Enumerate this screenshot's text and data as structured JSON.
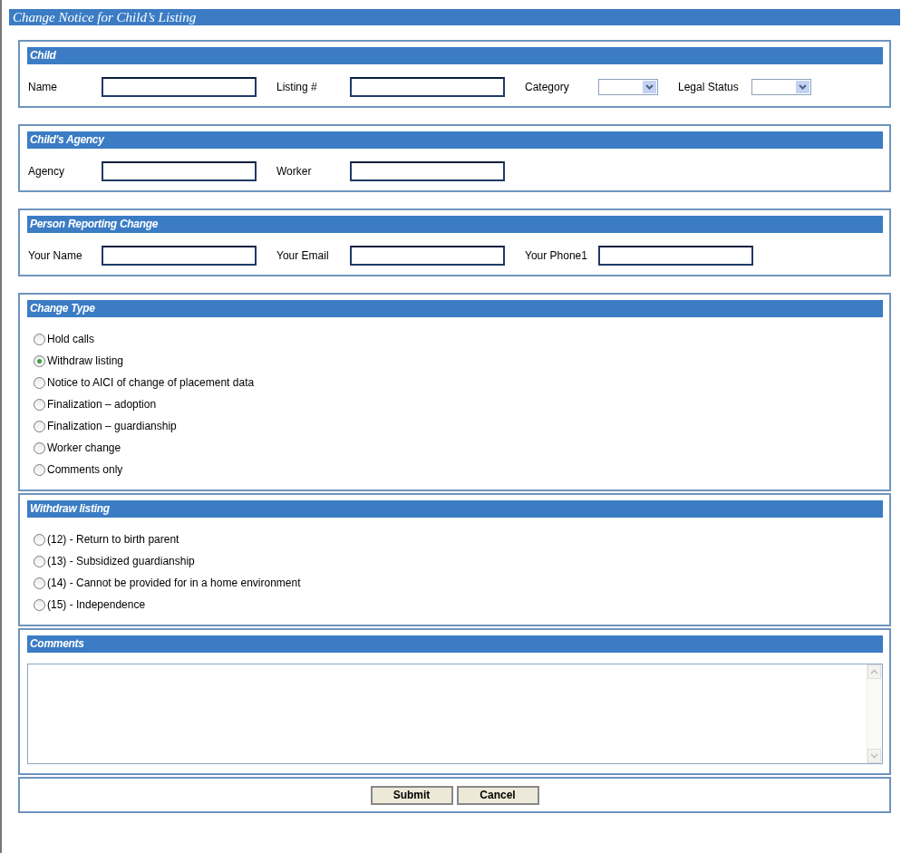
{
  "window": {
    "title": "Change Notice for Child’s Listing"
  },
  "sections": [
    {
      "kind": "fields",
      "title": "Child",
      "fields": [
        {
          "label": "Name",
          "kind": "text"
        },
        {
          "label": "Listing #",
          "kind": "text"
        },
        {
          "label": "Category",
          "kind": "select"
        },
        {
          "label": "Legal Status",
          "kind": "select"
        }
      ]
    },
    {
      "kind": "fields",
      "title": "Child's Agency",
      "fields": [
        {
          "label": "Agency",
          "kind": "text"
        },
        {
          "label": "Worker",
          "kind": "text"
        }
      ]
    },
    {
      "kind": "fields",
      "title": "Person Reporting Change",
      "fields": [
        {
          "label": "Your Name",
          "kind": "text"
        },
        {
          "label": "Your Email",
          "kind": "text"
        },
        {
          "label": "Your Phone1",
          "kind": "text"
        }
      ]
    },
    {
      "kind": "radios",
      "title": "Change Type",
      "options": [
        {
          "label": "Hold calls",
          "selected": false
        },
        {
          "label": "Withdraw listing",
          "selected": true
        },
        {
          "label": "Notice to AICI of change of placement data",
          "selected": false
        },
        {
          "label": "Finalization – adoption",
          "selected": false
        },
        {
          "label": "Finalization – guardianship",
          "selected": false
        },
        {
          "label": "Worker change",
          "selected": false
        },
        {
          "label": "Comments only",
          "selected": false
        }
      ]
    },
    {
      "kind": "radios",
      "title": "Withdraw listing",
      "options": [
        {
          "label": "(12) - Return to birth parent",
          "selected": false
        },
        {
          "label": "(13) - Subsidized guardianship",
          "selected": false
        },
        {
          "label": "(14) - Cannot be provided for in a home environment",
          "selected": false
        },
        {
          "label": "(15) - Independence",
          "selected": false
        }
      ]
    },
    {
      "kind": "textarea",
      "title": "Comments"
    }
  ],
  "buttons": [
    "Submit",
    "Cancel"
  ]
}
